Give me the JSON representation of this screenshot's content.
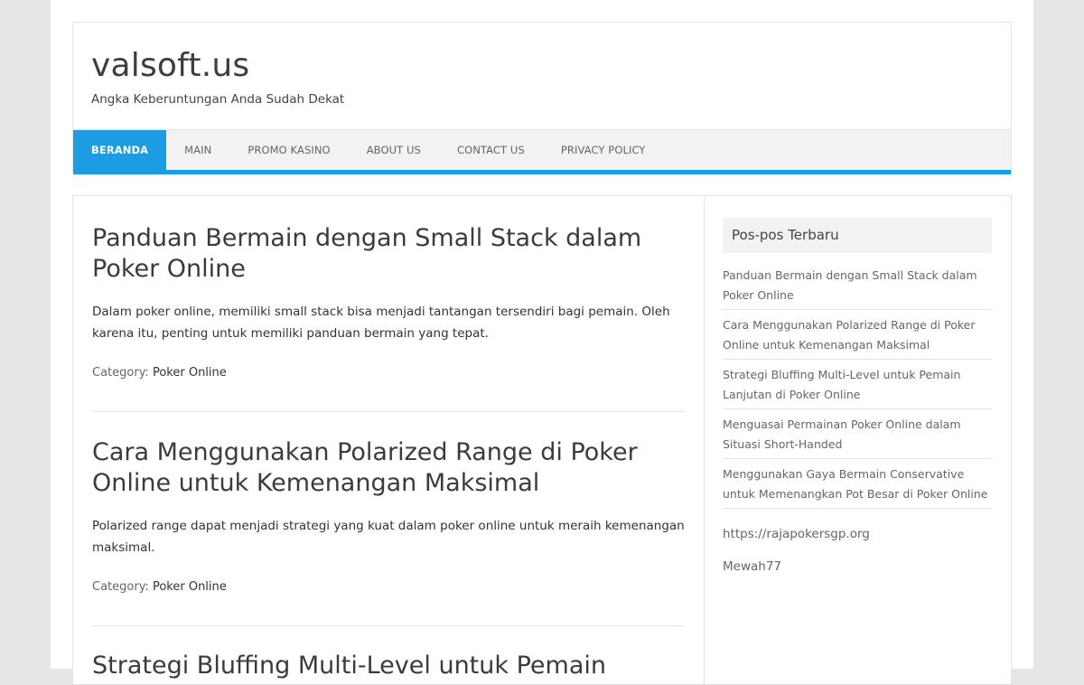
{
  "site": {
    "title": "valsoft.us",
    "description": "Angka Keberuntungan Anda Sudah Dekat"
  },
  "nav": {
    "items": [
      {
        "label": "BERANDA",
        "active": true
      },
      {
        "label": "MAIN",
        "active": false
      },
      {
        "label": "PROMO KASINO",
        "active": false
      },
      {
        "label": "ABOUT US",
        "active": false
      },
      {
        "label": "CONTACT US",
        "active": false
      },
      {
        "label": "PRIVACY POLICY",
        "active": false
      }
    ],
    "accent_color": "#1b9ce3"
  },
  "posts": [
    {
      "title": "Panduan Bermain dengan Small Stack dalam Poker Online",
      "excerpt": "Dalam poker online, memiliki small stack bisa menjadi tantangan tersendiri bagi pemain. Oleh karena itu, penting untuk memiliki panduan bermain yang tepat.",
      "category_label": "Category:",
      "category": "Poker Online"
    },
    {
      "title": "Cara Menggunakan Polarized Range di Poker Online untuk Kemenangan Maksimal",
      "excerpt": "Polarized range dapat menjadi strategi yang kuat dalam poker online untuk meraih kemenangan maksimal.",
      "category_label": "Category:",
      "category": "Poker Online"
    },
    {
      "title": "Strategi Bluffing Multi-Level untuk Pemain"
    }
  ],
  "sidebar": {
    "widget_title": "Pos-pos Terbaru",
    "recent_posts": [
      "Panduan Bermain dengan Small Stack dalam Poker Online",
      "Cara Menggunakan Polarized Range di Poker Online untuk Kemenangan Maksimal",
      "Strategi Bluffing Multi-Level untuk Pemain Lanjutan di Poker Online",
      "Menguasai Permainan Poker Online dalam Situasi Short-Handed",
      "Menggunakan Gaya Bermain Conservative untuk Memenangkan Pot Besar di Poker Online"
    ],
    "links": [
      "https://rajapokersgp.org",
      "Mewah77"
    ]
  }
}
